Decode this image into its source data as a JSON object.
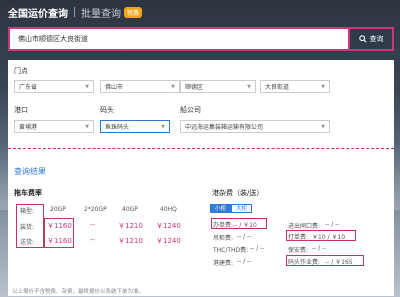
{
  "tabs": [
    {
      "label": "全国运价查询",
      "active": true
    },
    {
      "label": "批量查询",
      "active": false,
      "badge": "特惠"
    }
  ],
  "search": {
    "value": "佛山市顺德区大良街道",
    "button_label": "查询"
  },
  "form": {
    "origin_label": "门点",
    "origin_selects": [
      "广东省",
      "佛山市",
      "顺德区",
      "大良街道"
    ],
    "port_label": "港口",
    "port_value": "黄埔港",
    "terminal_label": "码头",
    "terminal_value": "鱼珠码头",
    "carrier_label": "船公司",
    "carrier_value": "中远海运集装箱运输有限公司"
  },
  "results": {
    "title": "查询结果",
    "trailer": {
      "title": "拖车费率",
      "headers": [
        "箱型:",
        "20GP",
        "2*20GP",
        "40GP",
        "40HQ"
      ],
      "rows": [
        {
          "label": "装货:",
          "values": [
            "￥1160",
            "--",
            "￥1210",
            "￥1240"
          ]
        },
        {
          "label": "送货:",
          "values": [
            "￥1160",
            "--",
            "￥1210",
            "￥1240"
          ]
        }
      ]
    },
    "misc": {
      "title": "港杂费（装/送）",
      "toggle": [
        "小柜",
        "大柜"
      ],
      "left_items": [
        {
          "label": "办单费:",
          "value": "-- / ￥10"
        },
        {
          "label": "吊柜费:",
          "value": "-- / --"
        },
        {
          "label": "THC/THD费:",
          "value": "-- / --"
        },
        {
          "label": "港建费:",
          "value": "-- / --"
        }
      ],
      "right_items": [
        {
          "label": "进出闸口费:",
          "value": "-- / --"
        },
        {
          "label": "打单费:",
          "value": "￥10 / ￥10"
        },
        {
          "label": "保安费:",
          "value": "-- / --"
        },
        {
          "label": "码头作业费:",
          "value": "-- / ￥165"
        }
      ]
    },
    "footnote": "以上报价不含税费、杂费，最终报价以系统下单为准。"
  }
}
